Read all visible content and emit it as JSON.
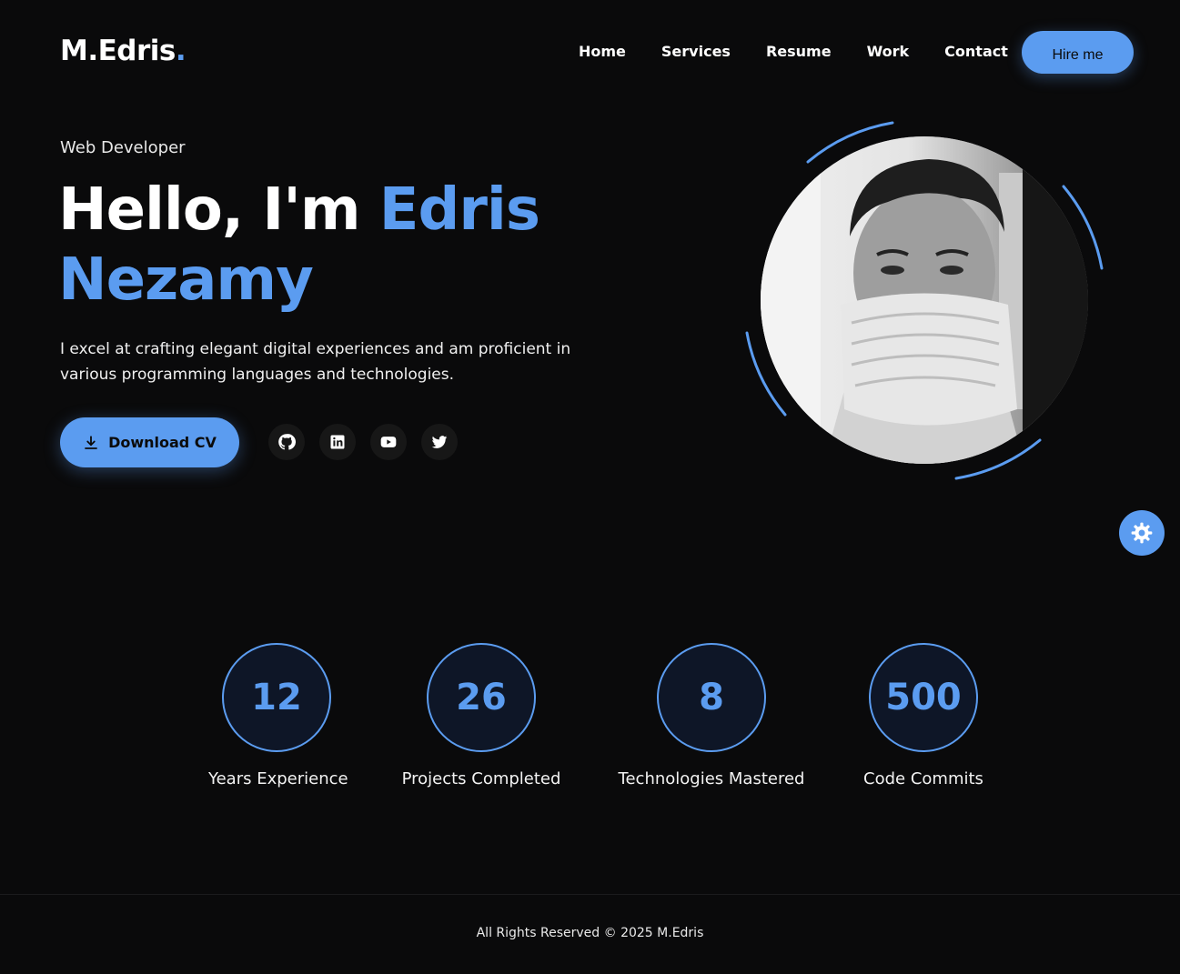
{
  "header": {
    "logo_text": "M.Edris",
    "logo_dot": ".",
    "nav": [
      "Home",
      "Services",
      "Resume",
      "Work",
      "Contact"
    ],
    "hire_label": "Hire me"
  },
  "hero": {
    "subtitle": "Web Developer",
    "greeting": "Hello, I'm ",
    "first_name": "Edris",
    "last_name": "Nezamy",
    "description": "I excel at crafting elegant digital experiences and am proficient in various programming languages and technologies.",
    "cv_label": "Download CV",
    "socials": [
      "github-icon",
      "linkedin-icon",
      "youtube-icon",
      "twitter-icon"
    ]
  },
  "stats": [
    {
      "value": "12",
      "label": "Years Experience"
    },
    {
      "value": "26",
      "label": "Projects Completed"
    },
    {
      "value": "8",
      "label": "Technologies Mastered"
    },
    {
      "value": "500",
      "label": "Code Commits"
    }
  ],
  "footer": {
    "text": "All Rights Reserved © 2025 M.Edris"
  },
  "colors": {
    "accent": "#5b9cf0",
    "background": "#0a0a0b"
  }
}
